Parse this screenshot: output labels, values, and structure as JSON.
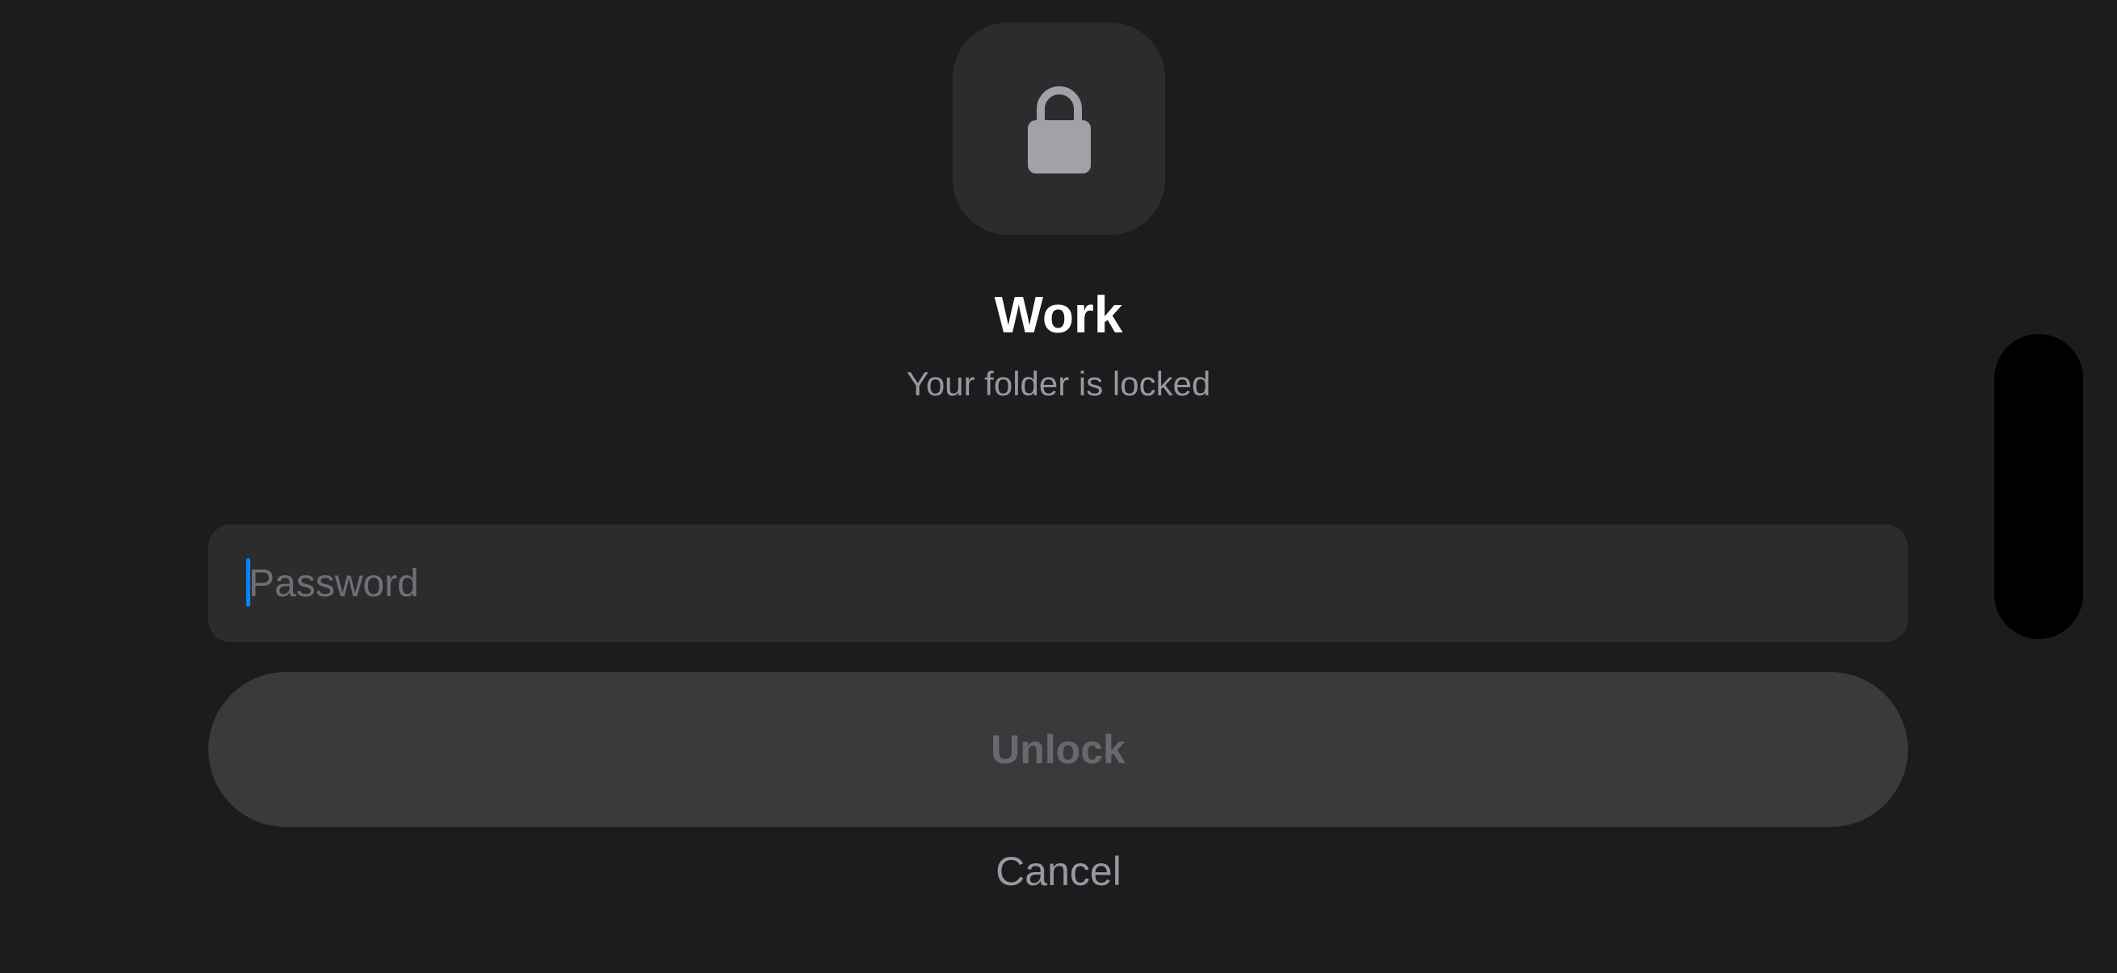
{
  "folder": {
    "icon": "lock-icon",
    "title": "Work",
    "subtitle": "Your folder is locked"
  },
  "password": {
    "value": "",
    "placeholder": "Password"
  },
  "actions": {
    "unlock_label": "Unlock",
    "cancel_label": "Cancel"
  },
  "colors": {
    "background": "#1c1c1e",
    "tile": "#2c2c2e",
    "button": "#3a3a3c",
    "caret": "#0a84ff",
    "title": "#ffffff",
    "secondary_text": "#98989e",
    "disabled_text": "#68686d"
  }
}
